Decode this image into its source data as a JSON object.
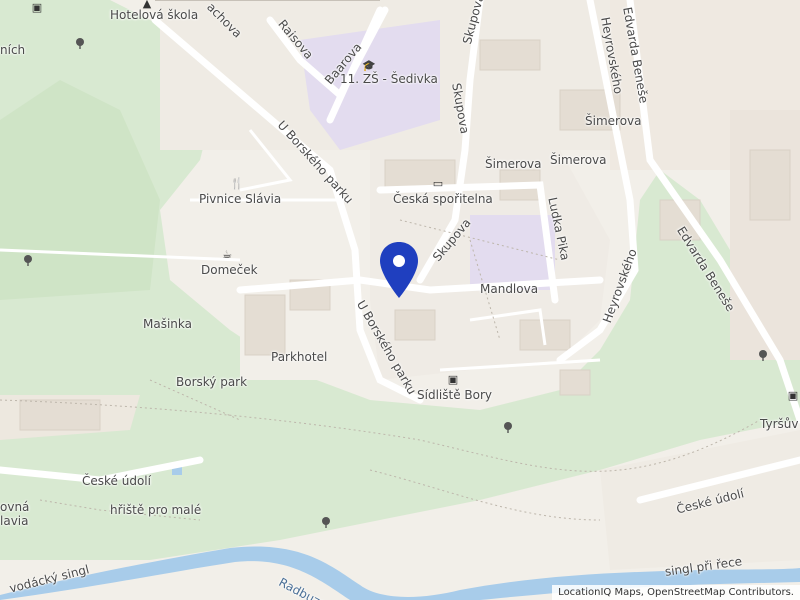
{
  "map": {
    "labels": {
      "hotelova_skola": "Hotelová škola",
      "zs_sedivka": "11. ZŠ - Šedivka",
      "pivnice_slavia": "Pivnice Slávia",
      "domecek": "Domeček",
      "masinka": "Mašinka",
      "parkhotel": "Parkhotel",
      "borsky_park": "Borský park",
      "ceska_sporitelna": "Česká spořitelna",
      "sidliste_bory": "Sídliště Bory",
      "ceske_udoli_left": "České údolí",
      "ceske_udoli_right": "České údolí",
      "hriste": "hřiště pro malé",
      "vodacky_singl": "vodácký singl",
      "radbuza": "Radbuza",
      "singl_pri_rece": "singl při řece",
      "tyrsuv": "Tyršův",
      "left_edge_top": "ních",
      "left_edge_mid1": "ovná",
      "left_edge_mid2": "lavia"
    },
    "streets": {
      "baarova": "Baarova",
      "raisova": "Raisova",
      "machova": "achova",
      "u_borskeho_parku_top": "U Borského parku",
      "u_borskeho_parku_bottom": "U Borského parku",
      "skupova_top": "Skupova",
      "skupova_mid": "Skupova",
      "simerova_1": "Šimerova",
      "simerova_2": "Šimerova",
      "simerova_3": "Šimerova",
      "ludka_pika": "Ludka Pika",
      "mandlova": "Mandlova",
      "heyrovskeho_top": "Heyrovského",
      "heyrovskeho_mid": "Heyrovského",
      "edvarda_benese_top": "Edvarda Beneše",
      "edvarda_benese_mid": "Edvarda Beneše"
    }
  },
  "attribution": "LocationIQ Maps, OpenStreetMap Contributors."
}
